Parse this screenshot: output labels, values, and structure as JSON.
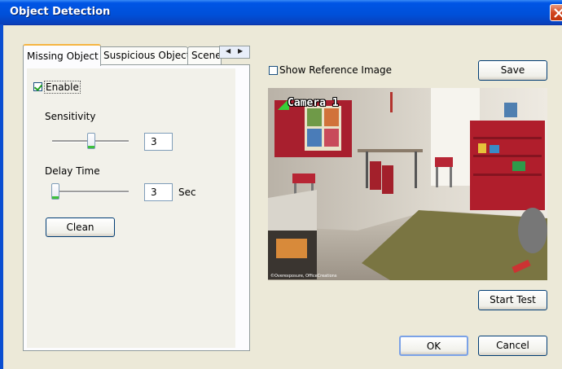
{
  "window": {
    "title": "Object Detection"
  },
  "tabs": [
    {
      "label": "Missing Object",
      "active": true
    },
    {
      "label": "Suspicious Object",
      "active": false
    },
    {
      "label": "Scene",
      "active": false
    }
  ],
  "missing_object": {
    "enable_label": "Enable",
    "enable_checked": true,
    "sensitivity_label": "Sensitivity",
    "sensitivity_value": "3",
    "delay_label": "Delay  Time",
    "delay_value": "3",
    "delay_unit": "Sec",
    "clean_label": "Clean"
  },
  "reference": {
    "show_reference_label": "Show Reference Image",
    "checked": false
  },
  "camera": {
    "label": "Camera 1",
    "credit": "©Overexposure, OfficeCreations\u0000"
  },
  "buttons": {
    "save": "Save",
    "start_test": "Start Test",
    "ok": "OK",
    "cancel": "Cancel"
  },
  "colors": {
    "titlebar": "#0055e5",
    "tab_accent": "#f6b542",
    "close": "#d2451f"
  }
}
